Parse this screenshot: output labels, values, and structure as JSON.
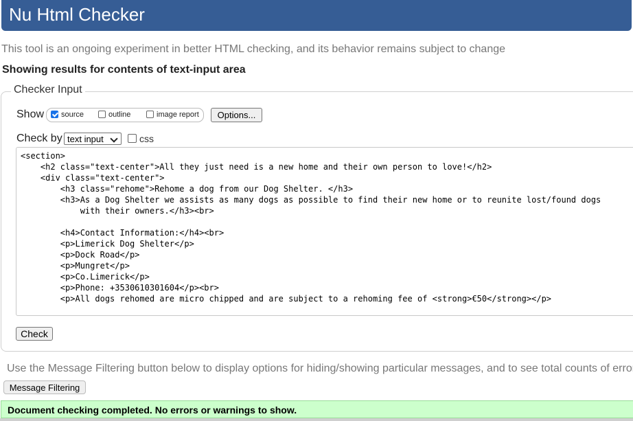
{
  "header": {
    "title": "Nu Html Checker"
  },
  "subtitle": "This tool is an ongoing experiment in better HTML checking, and its behavior remains subject to change",
  "results_heading": "Showing results for contents of text-input area",
  "checker_input": {
    "legend": "Checker Input",
    "show": {
      "label": "Show",
      "options": [
        {
          "label": "source",
          "checked": true
        },
        {
          "label": "outline",
          "checked": false
        },
        {
          "label": "image report",
          "checked": false
        }
      ],
      "options_button": "Options..."
    },
    "check_by": {
      "label": "Check by",
      "selected": "text input",
      "css_label": "css",
      "css_checked": false
    },
    "source_text": "<section>\n    <h2 class=\"text-center\">All they just need is a new home and their own person to love!</h2>\n    <div class=\"text-center\">\n        <h3 class=\"rehome\">Rehome a dog from our Dog Shelter. </h3>\n        <h3>As a Dog Shelter we assists as many dogs as possible to find their new home or to reunite lost/found dogs\n            with their owners.</h3><br>\n\n        <h4>Contact Information:</h4><br>\n        <p>Limerick Dog Shelter</p>\n        <p>Dock Road</p>\n        <p>Mungret</p>\n        <p>Co.Limerick</p>\n        <p>Phone: +3530610301604</p><br>\n        <p>All dogs rehomed are micro chipped and are subject to a rehoming fee of <strong>€50</strong></p>",
    "check_button": "Check"
  },
  "filtering": {
    "info": "Use the Message Filtering button below to display options for hiding/showing particular messages, and to see total counts of errors and warnings.",
    "button": "Message Filtering"
  },
  "result": {
    "message": "Document checking completed. No errors or warnings to show."
  },
  "colors": {
    "header_bg": "#365d95",
    "success_bg": "#ccffcc"
  }
}
